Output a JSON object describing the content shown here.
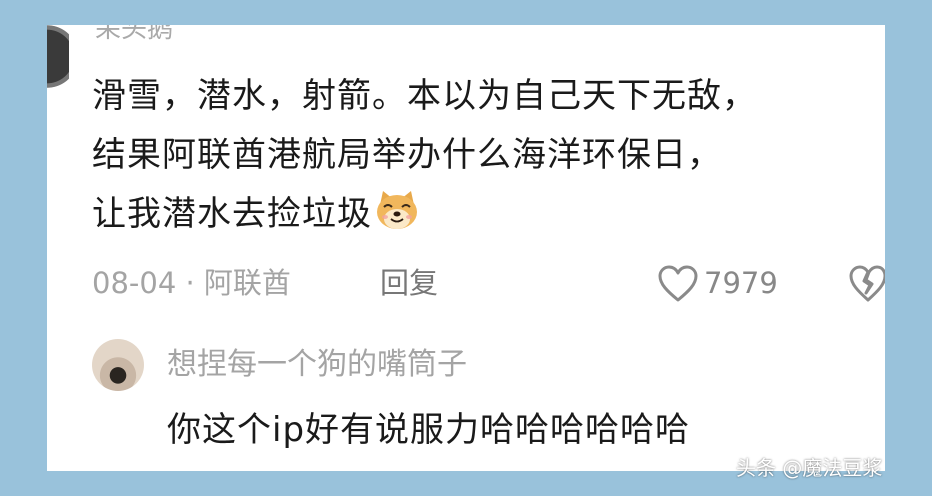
{
  "comment": {
    "username": "呆头鹅",
    "lines": [
      "滑雪，潜水，射箭。本以为自己天下无敌，",
      "结果阿联酋港航局举办什么海洋环保日，",
      "让我潜水去捡垃圾"
    ],
    "emoji": "doge-icon",
    "date_location": "08-04 · 阿联酋",
    "reply_label": "回复",
    "like_count": "7979"
  },
  "reply": {
    "username": "想捏每一个狗的嘴筒子",
    "text": "你这个ip好有说服力哈哈哈哈哈哈"
  },
  "watermark": "头条 @魔法豆浆",
  "colors": {
    "background": "#99c2db",
    "card": "#ffffff",
    "text_primary": "#1a1a1a",
    "text_secondary": "#a4a4a4"
  }
}
